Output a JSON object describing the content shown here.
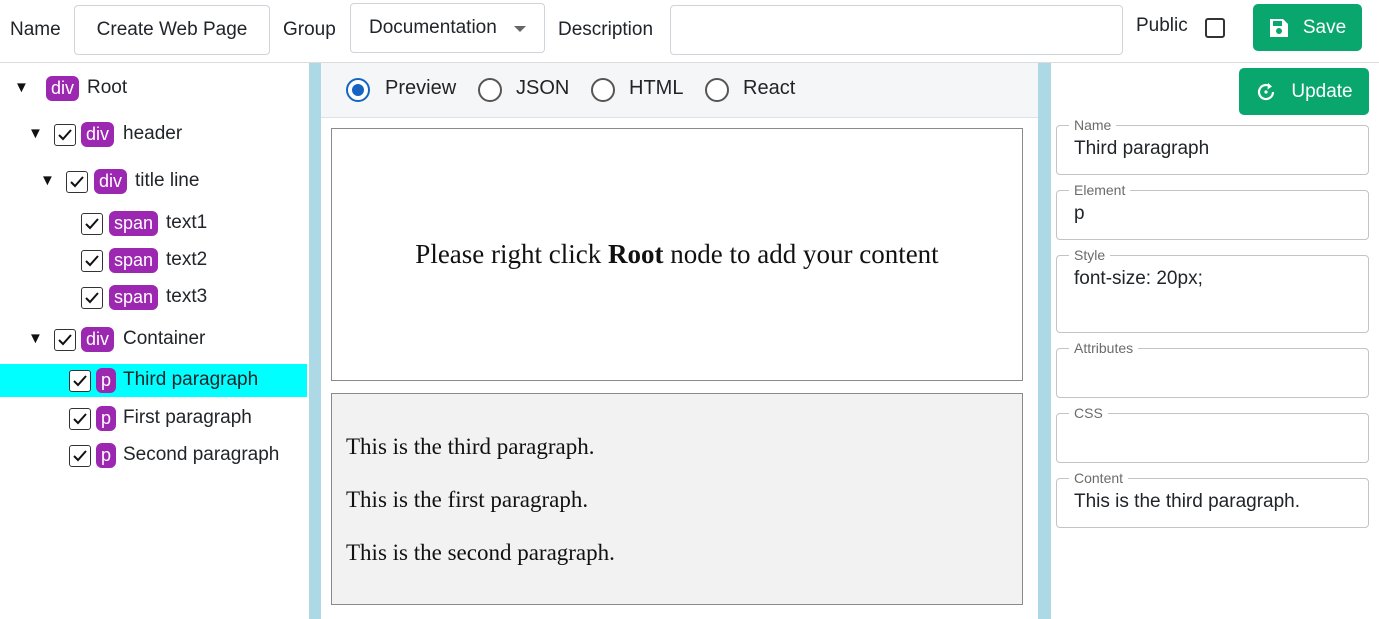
{
  "topbar": {
    "name_label": "Name",
    "name_value": "Create Web Page",
    "group_label": "Group",
    "group_value": "Documentation",
    "description_label": "Description",
    "description_value": "",
    "public_label": "Public",
    "public_checked": false,
    "save_label": "Save"
  },
  "tree": {
    "items": [
      {
        "tag": "div",
        "name": "Root"
      },
      {
        "tag": "div",
        "name": "header"
      },
      {
        "tag": "div",
        "name": "title line"
      },
      {
        "tag": "span",
        "name": "text1"
      },
      {
        "tag": "span",
        "name": "text2"
      },
      {
        "tag": "span",
        "name": "text3"
      },
      {
        "tag": "div",
        "name": "Container"
      },
      {
        "tag": "p",
        "name": "Third paragraph",
        "selected": true
      },
      {
        "tag": "p",
        "name": "First paragraph"
      },
      {
        "tag": "p",
        "name": "Second paragraph"
      }
    ]
  },
  "view_modes": {
    "selected": "Preview",
    "options": [
      "Preview",
      "JSON",
      "HTML",
      "React"
    ]
  },
  "preview": {
    "message_before": "Please right click ",
    "message_bold": "Root",
    "message_after": " node to add your content",
    "paragraphs": [
      "This is the third paragraph.",
      "This is the first paragraph.",
      "This is the second paragraph."
    ]
  },
  "properties": {
    "update_label": "Update",
    "fields": [
      {
        "label": "Name",
        "value": "Third paragraph"
      },
      {
        "label": "Element",
        "value": "p"
      },
      {
        "label": "Style",
        "value": "font-size: 20px;"
      },
      {
        "label": "Attributes",
        "value": ""
      },
      {
        "label": "CSS",
        "value": ""
      },
      {
        "label": "Content",
        "value": "This is the third paragraph."
      }
    ]
  },
  "colors": {
    "accent_green": "#09a66d",
    "tag_purple": "#9c27b0",
    "selection_cyan": "#00ffff",
    "divider_blue": "#add8e6",
    "radio_blue": "#1565c0"
  }
}
